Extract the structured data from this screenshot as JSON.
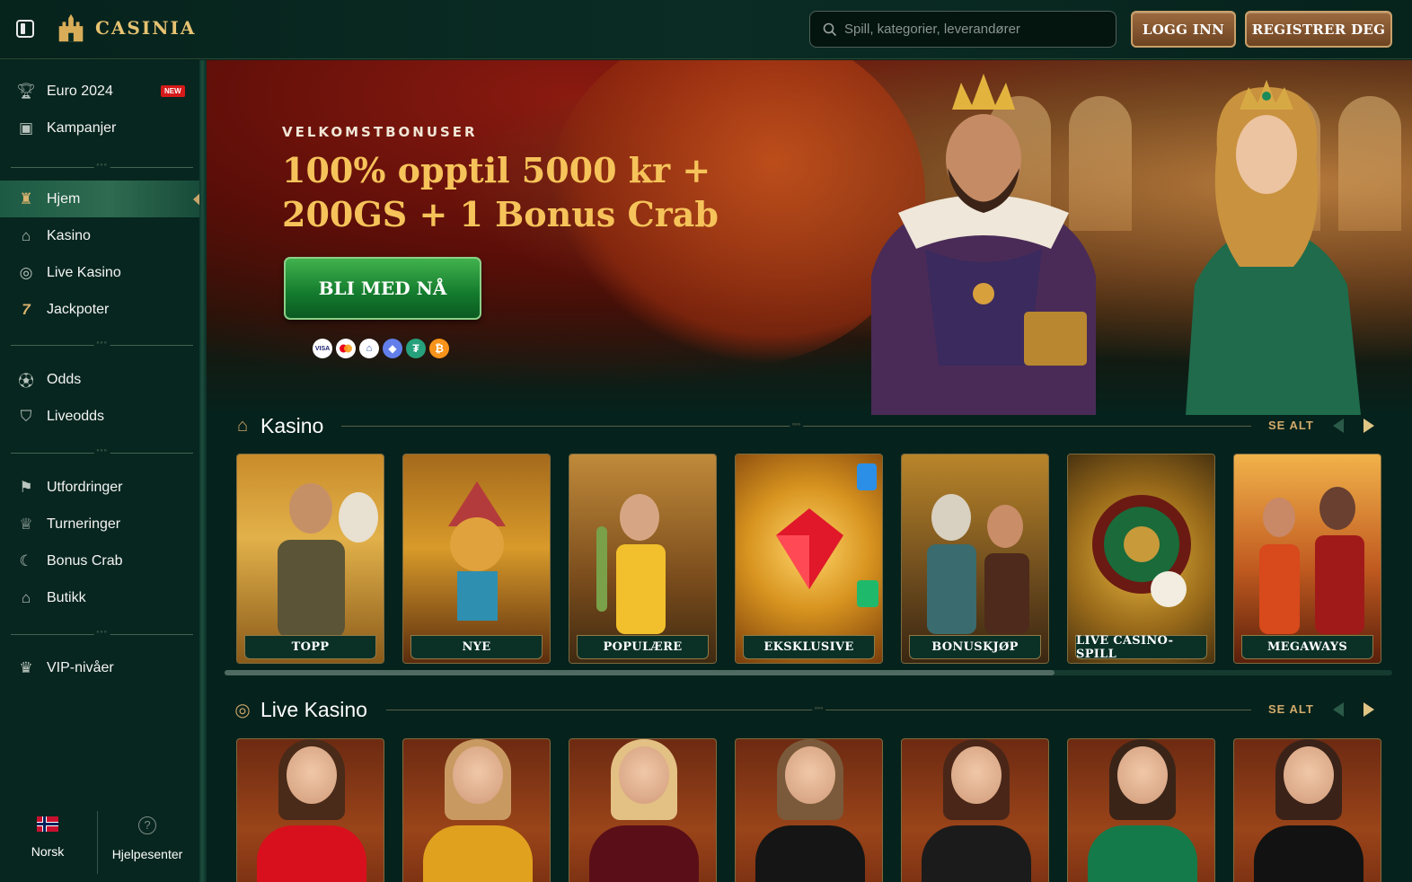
{
  "header": {
    "logo_text": "CASINIA",
    "search_placeholder": "Spill, kategorier, leverandører",
    "login_label": "LOGG INN",
    "register_label": "REGISTRER DEG"
  },
  "sidebar": {
    "group1": [
      {
        "label": "Euro 2024",
        "icon": "trophy-icon",
        "badge": "NEW"
      },
      {
        "label": "Kampanjer",
        "icon": "gift-box-icon"
      }
    ],
    "group2": [
      {
        "label": "Hjem",
        "icon": "castle-home-icon",
        "active": true
      },
      {
        "label": "Kasino",
        "icon": "casino-building-icon"
      },
      {
        "label": "Live Kasino",
        "icon": "chip-icon"
      },
      {
        "label": "Jackpoter",
        "icon": "seven-icon"
      }
    ],
    "group3": [
      {
        "label": "Odds",
        "icon": "soccer-ball-icon"
      },
      {
        "label": "Liveodds",
        "icon": "shield-icon"
      }
    ],
    "group4": [
      {
        "label": "Utfordringer",
        "icon": "challenge-icon"
      },
      {
        "label": "Turneringer",
        "icon": "cup-icon"
      },
      {
        "label": "Bonus Crab",
        "icon": "crab-claw-icon"
      },
      {
        "label": "Butikk",
        "icon": "shop-icon"
      }
    ],
    "group5": [
      {
        "label": "VIP-nivåer",
        "icon": "crown-icon"
      }
    ],
    "footer": {
      "language": "Norsk",
      "help": "Hjelpesenter"
    }
  },
  "hero": {
    "kicker": "VELKOMSTBONUSER",
    "title_line1": "100% opptil 5000 kr +",
    "title_line2": "200GS + 1 Bonus Crab",
    "cta": "BLI MED NÅ",
    "payments": [
      "VISA",
      "MC",
      "BANK",
      "ETH",
      "USDT",
      "BTC"
    ]
  },
  "kasino": {
    "title": "Kasino",
    "see_all": "SE ALT",
    "categories": [
      "TOPP",
      "NYE",
      "POPULÆRE",
      "EKSKLUSIVE",
      "BONUSKJØP",
      "LIVE CASINO-SPILL",
      "MEGAWAYS"
    ]
  },
  "live": {
    "title": "Live Kasino",
    "see_all": "SE ALT"
  },
  "colors": {
    "gold": "#f6c35a",
    "accent_brown": "#8b5a30",
    "green_cta": "#1d8a36",
    "bg": "#06221c"
  }
}
